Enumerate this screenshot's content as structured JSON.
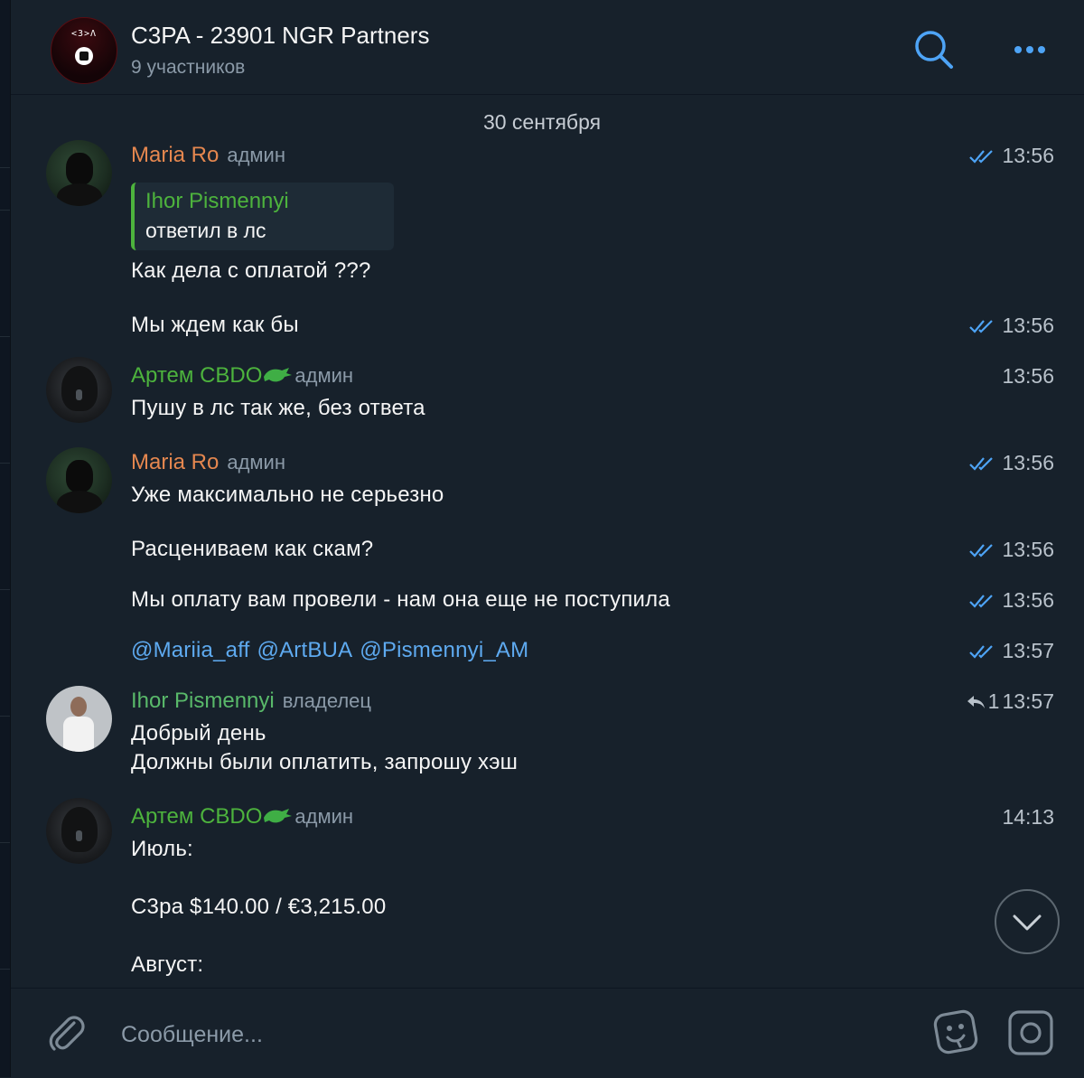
{
  "header": {
    "title": "C3PA - 23901 NGR Partners",
    "subtitle": "9 участников",
    "avatar_text": "<3>Λ"
  },
  "date_separator": "30 сентября",
  "messages": [
    {
      "sender": "Maria Ro",
      "role": "админ",
      "time": "13:56",
      "reply": {
        "name": "Ihor Pismennyi",
        "text": "ответил в лс"
      },
      "lines": [
        "Как дела с оплатой ???",
        "Мы ждем как бы"
      ],
      "line2_time": "13:56"
    },
    {
      "sender": "Артем СВDО",
      "role": "админ",
      "time": "13:56",
      "lines": [
        "Пушу в лс так же, без ответа"
      ]
    },
    {
      "sender": "Maria Ro",
      "role": "админ",
      "time": "13:56",
      "lines": [
        "Уже максимально не серьезно",
        "Расцениваем как скам?",
        "Мы оплату вам провели - нам она еще не поступила"
      ],
      "line2_time": "13:56",
      "line3_time": "13:56",
      "mentions": [
        "@Mariia_aff",
        "@ArtBUA",
        "@Pismennyi_AM"
      ],
      "mentions_time": "13:57"
    },
    {
      "sender": "Ihor Pismennyi",
      "role": "владелец",
      "time": "13:57",
      "reply_count": "1",
      "lines": [
        "Добрый день",
        "Должны были оплатить, запрошу хэш"
      ]
    },
    {
      "sender": "Артем СВDО",
      "role": "админ",
      "time": "14:13",
      "lines": [
        "Июль:",
        "C3pa $140.00 / €3,215.00",
        "Август:"
      ]
    }
  ],
  "composer": {
    "placeholder": "Сообщение..."
  },
  "colors": {
    "background": "#17212b",
    "accent_blue": "#5eaaf0",
    "maria_name": "#e5874f",
    "green_name": "#4db33d",
    "meta_text": "#8b9aa8"
  },
  "icons": [
    "search-icon",
    "more-icon",
    "double-check-icon",
    "reply-arrow-icon",
    "chevron-down-icon",
    "paperclip-icon",
    "sticker-icon",
    "camera-icon",
    "dragon-badge-icon"
  ]
}
